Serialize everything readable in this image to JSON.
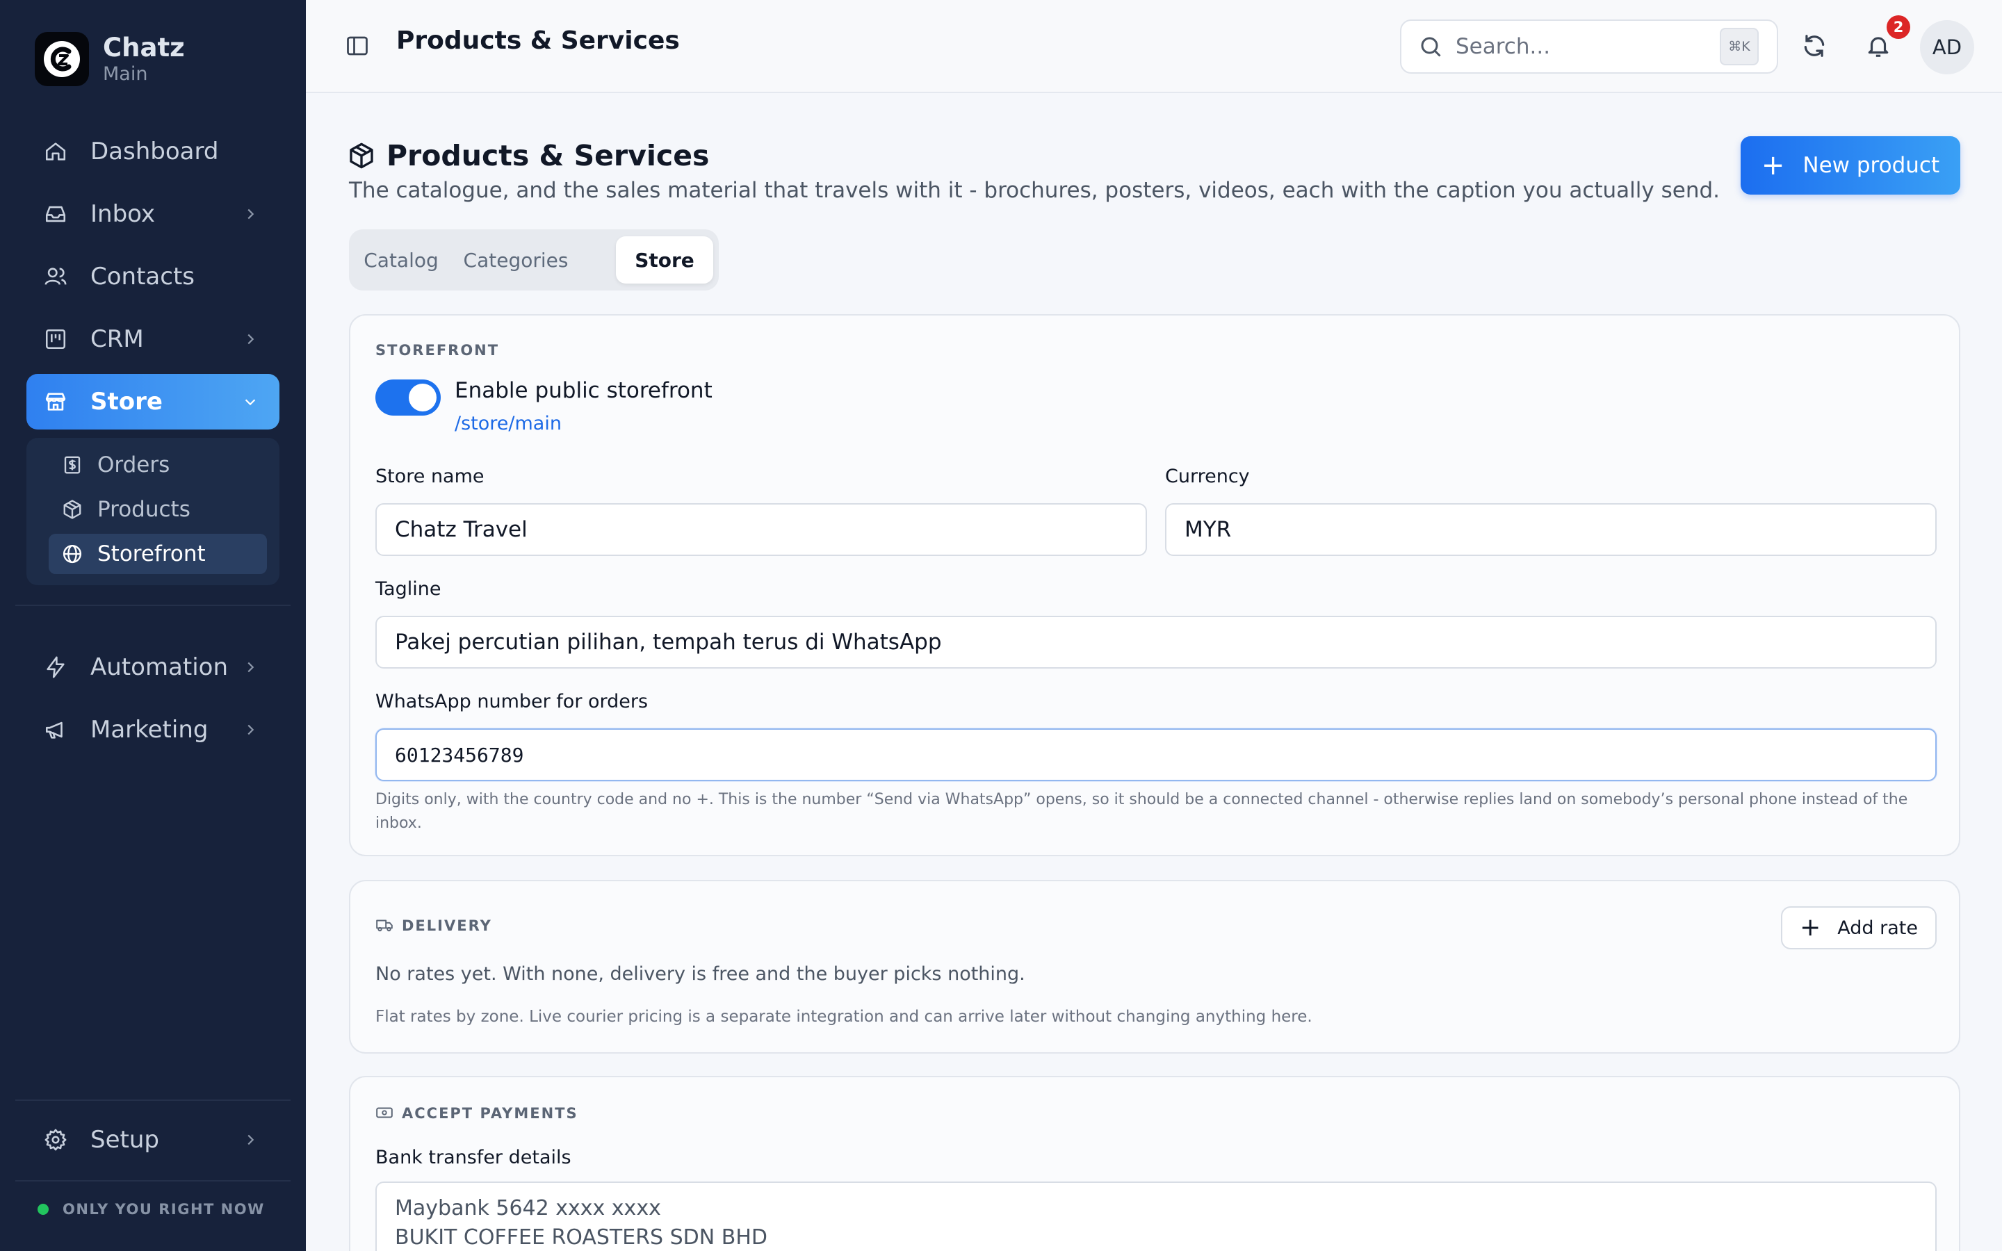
{
  "brand": {
    "name": "Chatz",
    "workspace": "Main"
  },
  "sidebar": {
    "items": [
      {
        "label": "Dashboard",
        "icon": "home-icon"
      },
      {
        "label": "Inbox",
        "icon": "inbox-icon"
      },
      {
        "label": "Contacts",
        "icon": "contacts-icon"
      },
      {
        "label": "CRM",
        "icon": "kanban-icon"
      },
      {
        "label": "Store",
        "icon": "store-icon"
      },
      {
        "label": "Automation",
        "icon": "lightning-icon"
      },
      {
        "label": "Marketing",
        "icon": "megaphone-icon"
      }
    ],
    "store_sub": [
      {
        "label": "Orders",
        "icon": "receipt-icon"
      },
      {
        "label": "Products",
        "icon": "package-icon"
      },
      {
        "label": "Storefront",
        "icon": "globe-icon"
      }
    ],
    "setup": "Setup",
    "presence": "ONLY YOU RIGHT NOW"
  },
  "topbar": {
    "title": "Products & Services",
    "search_placeholder": "Search...",
    "shortcut": "⌘K",
    "notification_count": "2",
    "avatar_initials": "AD"
  },
  "page": {
    "title": "Products & Services",
    "subtitle": "The catalogue, and the sales material that travels with it - brochures, posters, videos, each with the caption you actually send.",
    "new_button": "New product",
    "tabs": [
      "Catalog",
      "Categories",
      "Store"
    ],
    "active_tab": "Store"
  },
  "storefront": {
    "section": "STOREFRONT",
    "toggle_label": "Enable public storefront",
    "toggle_on": true,
    "link": "/store/main",
    "store_name_label": "Store name",
    "store_name": "Chatz Travel",
    "currency_label": "Currency",
    "currency": "MYR",
    "tagline_label": "Tagline",
    "tagline": "Pakej percutian pilihan, tempah terus di WhatsApp",
    "whatsapp_label": "WhatsApp number for orders",
    "whatsapp": "60123456789",
    "whatsapp_hint": "Digits only, with the country code and no +. This is the number “Send via WhatsApp” opens, so it should be a connected channel - otherwise replies land on somebody’s personal phone instead of the inbox."
  },
  "delivery": {
    "section": "DELIVERY",
    "add_rate": "Add rate",
    "empty_text": "No rates yet. With none, delivery is free and the buyer picks nothing.",
    "note": "Flat rates by zone. Live courier pricing is a separate integration and can arrive later without changing anything here."
  },
  "payments": {
    "section": "ACCEPT PAYMENTS",
    "bank_label": "Bank transfer details",
    "bank_line1": "Maybank 5642 xxxx xxxx",
    "bank_line2": "BUKIT COFFEE ROASTERS SDN BHD"
  },
  "colors": {
    "sidebar_bg": "#17223b",
    "accent": "#2f80f0",
    "link": "#1d6ae6",
    "badge": "#dc2626",
    "online": "#22c55e"
  }
}
